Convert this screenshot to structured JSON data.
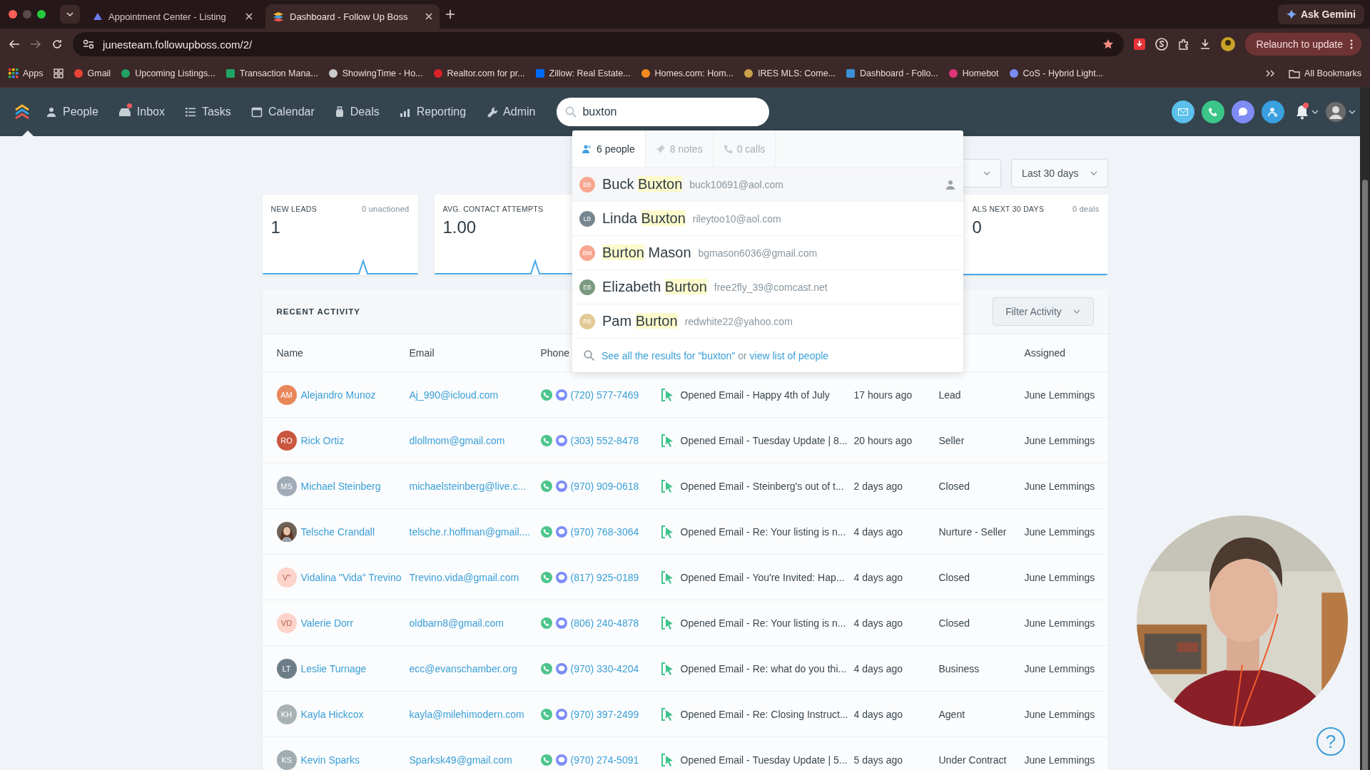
{
  "browser": {
    "tabs": [
      {
        "title": "Appointment Center - Listing",
        "selected": false
      },
      {
        "title": "Dashboard - Follow Up Boss",
        "selected": true
      }
    ],
    "assistant_button": "Ask Gemini",
    "url": "junesteam.followupboss.com/2/",
    "relaunch_button": "Relaunch to update",
    "bookmarks": [
      "Apps",
      "Gmail",
      "Upcoming Listings...",
      "Transaction Mana...",
      "ShowingTime - Ho...",
      "Realtor.com for pr...",
      "Zillow: Real Estate...",
      "Homes.com: Hom...",
      "IRES MLS: Come...",
      "Dashboard - Follo...",
      "Homebot",
      "CoS - Hybrid Light..."
    ],
    "all_bookmarks": "All Bookmarks"
  },
  "nav": {
    "items": [
      {
        "label": "People",
        "badge": false
      },
      {
        "label": "Inbox",
        "badge": true
      },
      {
        "label": "Tasks",
        "badge": false
      },
      {
        "label": "Calendar",
        "badge": false
      },
      {
        "label": "Deals",
        "badge": false
      },
      {
        "label": "Reporting",
        "badge": false
      },
      {
        "label": "Admin",
        "badge": false
      }
    ],
    "search": {
      "value": "buxton"
    },
    "notifications_badge": true
  },
  "search_results": {
    "tabs": [
      {
        "label": "6 people",
        "selected": true
      },
      {
        "label": "8 notes",
        "selected": false
      },
      {
        "label": "0 calls",
        "selected": false
      }
    ],
    "people": [
      {
        "initials": "BB",
        "color": "#f7a68f",
        "name": [
          {
            "text": "Buck",
            "highlight": false
          },
          {
            "text": "Buxton",
            "highlight": true
          }
        ],
        "email": "buck10691@aol.com",
        "selected": true
      },
      {
        "initials": "LB",
        "color": "#76858f",
        "name": [
          {
            "text": "Linda",
            "highlight": false
          },
          {
            "text": "Buxton",
            "highlight": true
          }
        ],
        "email": "rileytoo10@aol.com",
        "selected": false
      },
      {
        "initials": "BM",
        "color": "#f7a68f",
        "name": [
          {
            "text": "Burton",
            "highlight": true
          },
          {
            "text": "Mason",
            "highlight": false
          }
        ],
        "email": "bgmason6036@gmail.com",
        "selected": false
      },
      {
        "initials": "EB",
        "color": "#7a9a80",
        "name": [
          {
            "text": "Elizabeth",
            "highlight": false
          },
          {
            "text": "Burton",
            "highlight": true
          }
        ],
        "email": "free2fly_39@comcast.net",
        "selected": false
      },
      {
        "initials": "PB",
        "color": "#e2c995",
        "name": [
          {
            "text": "Pam",
            "highlight": false
          },
          {
            "text": "Burton",
            "highlight": true
          }
        ],
        "email": "redwhite22@yahoo.com",
        "selected": false
      }
    ],
    "footer": {
      "all_results_link": "See all the results for \"buxton\"",
      "connector": "or",
      "list_link": "view list of people"
    }
  },
  "date_range": "Last 30 days",
  "cards": [
    {
      "label": "NEW LEADS",
      "note": "0 unactioned",
      "value": "1"
    },
    {
      "label": "AVG. CONTACT ATTEMPTS",
      "value": "1.00"
    },
    {
      "label": "ALS NEXT 30 DAYS",
      "note": "0 deals",
      "value": "0"
    }
  ],
  "activity": {
    "title": "RECENT ACTIVITY",
    "filter_button": "Filter Activity",
    "columns": [
      "Name",
      "Email",
      "Phone",
      "Assigned"
    ],
    "rows": [
      {
        "initials": "AM",
        "color": "#e8875a",
        "photo": false,
        "name": "Alejandro Munoz",
        "email": "Aj_990@icloud.com",
        "phone": "(720) 577-7469",
        "activity": "Opened Email - Happy 4th of July",
        "time": "17 hours ago",
        "stage": "Lead",
        "assigned": "June Lemmings"
      },
      {
        "initials": "RO",
        "color": "#c9573f",
        "photo": false,
        "name": "Rick Ortiz",
        "email": "dlollmom@gmail.com",
        "phone": "(303) 552-8478",
        "activity": "Opened Email - Tuesday Update | 8...",
        "time": "20 hours ago",
        "stage": "Seller",
        "assigned": "June Lemmings"
      },
      {
        "initials": "MS",
        "color": "#a1abb7",
        "photo": false,
        "name": "Michael Steinberg",
        "email": "michaelsteinberg@live.c...",
        "phone": "(970) 909-0618",
        "activity": "Opened Email - Steinberg's out of t...",
        "time": "2 days ago",
        "stage": "Closed",
        "assigned": "June Lemmings"
      },
      {
        "photo": true,
        "name": "Telsche Crandall",
        "email": "telsche.r.hoffman@gmail....",
        "phone": "(970) 768-3064",
        "activity": "Opened Email - Re: Your listing is n...",
        "time": "4 days ago",
        "stage": "Nurture - Seller",
        "assigned": "June Lemmings"
      },
      {
        "initials": "V\"",
        "color": "#fdd3ca",
        "photo": false,
        "name": "Vidalina \"Vida\" Trevino",
        "email": "Trevino.vida@gmail.com",
        "phone": "(817) 925-0189",
        "activity": "Opened Email - You're Invited: Hap...",
        "time": "4 days ago",
        "stage": "Closed",
        "assigned": "June Lemmings"
      },
      {
        "initials": "VD",
        "color": "#fdd3ca",
        "photo": false,
        "name": "Valerie Dorr",
        "email": "oldbarn8@gmail.com",
        "phone": "(806) 240-4878",
        "activity": "Opened Email - Re: Your listing is n...",
        "time": "4 days ago",
        "stage": "Closed",
        "assigned": "June Lemmings"
      },
      {
        "initials": "LT",
        "color": "#6c7d87",
        "photo": false,
        "name": "Leslie Turnage",
        "email": "ecc@evanschamber.org",
        "phone": "(970) 330-4204",
        "activity": "Opened Email - Re: what do you thi...",
        "time": "4 days ago",
        "stage": "Business",
        "assigned": "June Lemmings"
      },
      {
        "initials": "KH",
        "color": "#a8b2b5",
        "photo": false,
        "name": "Kayla Hickcox",
        "email": "kayla@milehimodern.com",
        "phone": "(970) 397-2499",
        "activity": "Opened Email - Re: Closing Instruct...",
        "time": "4 days ago",
        "stage": "Agent",
        "assigned": "June Lemmings"
      },
      {
        "initials": "KS",
        "color": "#a1abb2",
        "photo": false,
        "name": "Kevin Sparks",
        "email": "Sparksk49@gmail.com",
        "phone": "(970) 274-5091",
        "activity": "Opened Email - Tuesday Update | 5...",
        "time": "5 days ago",
        "stage": "Under Contract",
        "assigned": "June Lemmings"
      }
    ]
  },
  "help_button": "?"
}
